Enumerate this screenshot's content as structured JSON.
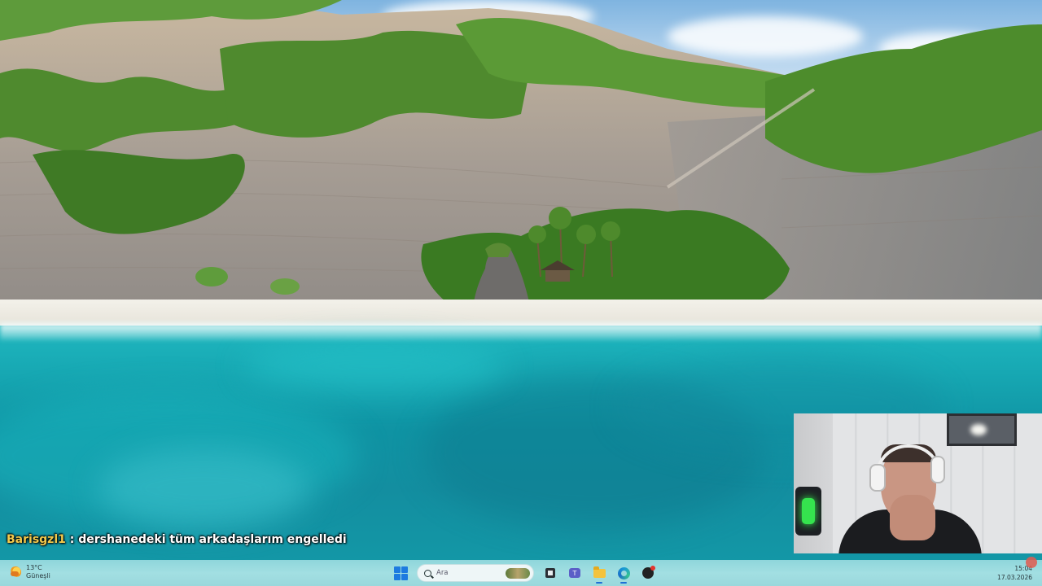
{
  "chat": {
    "username": "Barisgzl1",
    "separator": " : ",
    "message": "dershanedeki tüm arkadaşlarım engelledi"
  },
  "taskbar": {
    "weather": {
      "temperature": "13°C",
      "condition": "Güneşli",
      "icon": "sun-cloud-icon"
    },
    "search": {
      "placeholder": "Ara",
      "icon": "search-icon"
    },
    "apps": [
      {
        "name": "start",
        "icon": "windows-logo-icon"
      },
      {
        "name": "task-view",
        "icon": "task-view-icon"
      },
      {
        "name": "teams",
        "icon": "teams-icon"
      },
      {
        "name": "file-explorer",
        "icon": "folder-icon"
      },
      {
        "name": "edge",
        "icon": "edge-browser-icon"
      },
      {
        "name": "app",
        "icon": "app-icon"
      }
    ],
    "clock": {
      "time": "15:04",
      "date": "17.03.2026"
    }
  },
  "colors": {
    "chat_username": "#f2c94c",
    "taskbar_bg": "#9ad8dc",
    "sea": "#138ea0",
    "accent": "#1d7be0"
  }
}
